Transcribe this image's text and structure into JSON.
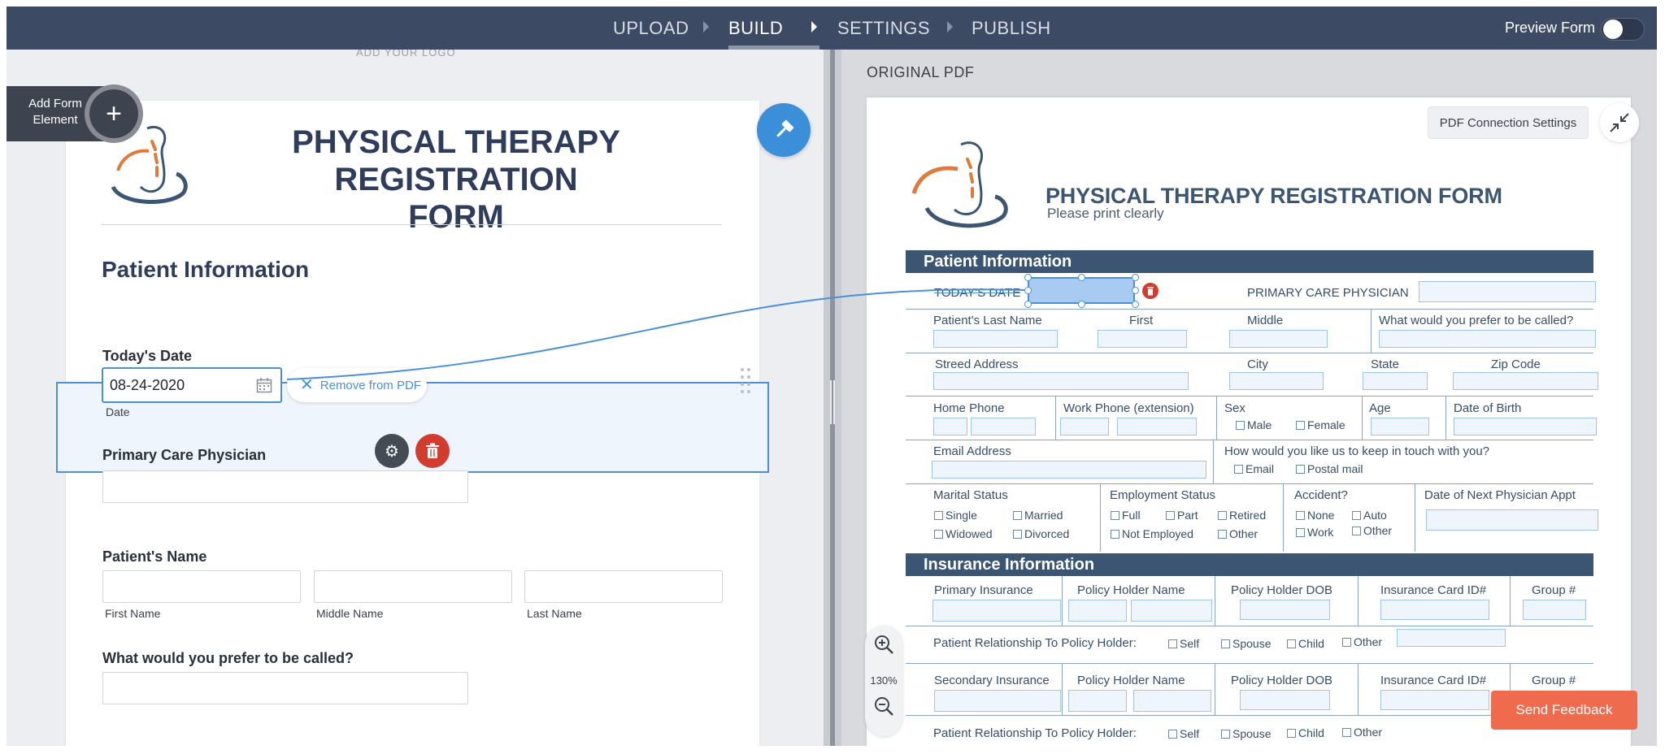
{
  "topbar": {
    "steps": [
      "UPLOAD",
      "BUILD",
      "SETTINGS",
      "PUBLISH"
    ],
    "active_step": "BUILD",
    "preview_label": "Preview Form",
    "preview_enabled": false
  },
  "builder": {
    "add_logo_hint": "ADD YOUR LOGO",
    "add_element_label": "Add Form Element",
    "form_title": "PHYSICAL THERAPY REGISTRATION FORM",
    "section_title": "Patient Information",
    "fields": {
      "todays_date": {
        "label": "Today's Date",
        "value": "08-24-2020",
        "sublabel": "Date",
        "remove_label": "Remove from PDF"
      },
      "primary_care": {
        "label": "Primary Care Physician"
      },
      "patient_name": {
        "label": "Patient's Name",
        "sub": [
          "First Name",
          "Middle Name",
          "Last Name"
        ]
      },
      "preferred_name": {
        "label": "What would you prefer to be called?"
      }
    }
  },
  "pdf": {
    "pane_title": "ORIGINAL PDF",
    "connection_settings": "PDF Connection Settings",
    "title": "PHYSICAL THERAPY REGISTRATION FORM",
    "subtitle": "Please print clearly",
    "patient_bar": "Patient Information",
    "insurance_bar": "Insurance Information",
    "labels": {
      "todays_date": "TODAY'S DATE",
      "primary_care": "PRIMARY CARE PHYSICIAN",
      "last_name": "Patient's Last Name",
      "first": "First",
      "middle": "Middle",
      "called": "What would you prefer to be called?",
      "street": "Streed Address",
      "city": "City",
      "state": "State",
      "zip": "Zip Code",
      "home_phone": "Home Phone",
      "work_phone": "Work Phone (extension)",
      "sex": "Sex",
      "age": "Age",
      "dob": "Date of Birth",
      "email": "Email Address",
      "keep_touch": "How would you like us to keep in touch with you?",
      "marital": "Marital Status",
      "employment": "Employment Status",
      "accident": "Accident?",
      "next_appt": "Date of Next Physician Appt",
      "primary_ins": "Primary Insurance",
      "holder_name": "Policy Holder Name",
      "holder_dob": "Policy Holder DOB",
      "card_id": "Insurance Card ID#",
      "group": "Group #",
      "relationship": "Patient Relationship To Policy Holder:",
      "secondary_ins": "Secondary Insurance"
    },
    "options": {
      "sex": [
        "Male",
        "Female"
      ],
      "contact": [
        "Email",
        "Postal mail"
      ],
      "marital": [
        "Single",
        "Married",
        "Widowed",
        "Divorced"
      ],
      "employment": [
        "Full",
        "Part",
        "Retired",
        "Not Employed",
        "Other"
      ],
      "accident": [
        "None",
        "Auto",
        "Work",
        "Other"
      ],
      "relationship": [
        "Self",
        "Spouse",
        "Child",
        "Other"
      ]
    },
    "zoom": "130%"
  },
  "feedback_label": "Send Feedback",
  "colors": {
    "topbar": "#3d4a63",
    "accent": "#4a90d9",
    "danger": "#d23c2e",
    "feedback": "#f06a4d",
    "pdf_bar": "#3b5572"
  }
}
